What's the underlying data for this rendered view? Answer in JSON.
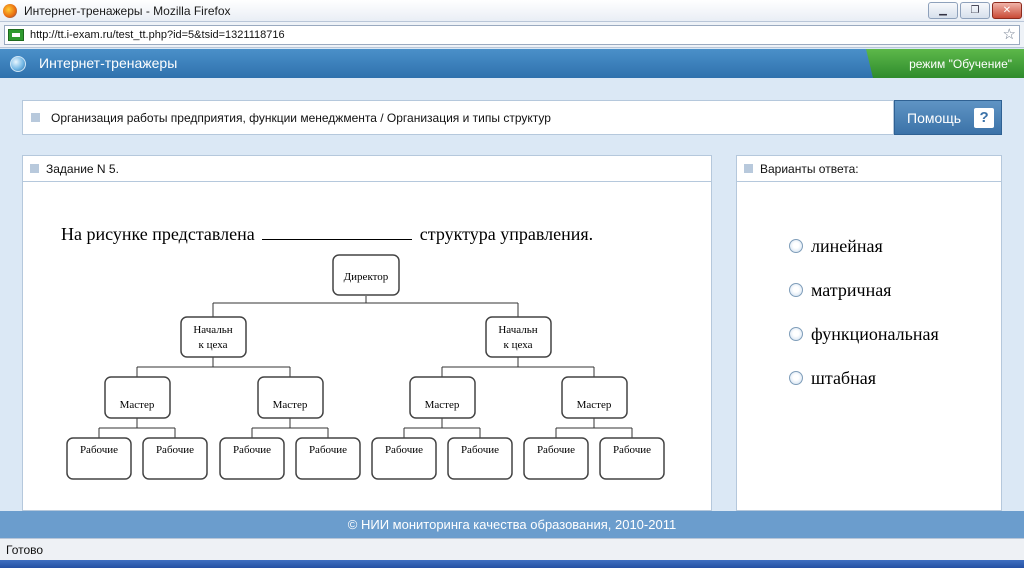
{
  "window": {
    "title": "Интернет-тренажеры - Mozilla Firefox",
    "buttons": {
      "minimize": "▁",
      "maximize": "❐",
      "close": "✕"
    }
  },
  "address_bar": {
    "url": "http://tt.i-exam.ru/test_tt.php?id=5&tsid=1321118716",
    "bookmark_icon": "star-icon"
  },
  "app_header": {
    "title": "Интернет-тренажеры",
    "mode": "режим \"Обучение\""
  },
  "breadcrumb": {
    "text": "Организация работы предприятия, функции менеджмента / Организация и типы структур"
  },
  "help": {
    "label": "Помощь",
    "icon": "?"
  },
  "task": {
    "title": "Задание N 5.",
    "question_before": "На рисунке представлена",
    "question_after": "структура управления.",
    "org_chart": {
      "director": "Директор",
      "heads": [
        "Начальник цеха",
        "Начальник цеха"
      ],
      "head_lines": [
        "Начальн",
        "к цеха"
      ],
      "masters": [
        "Мастер",
        "Мастер",
        "Мастер",
        "Мастер"
      ],
      "workers": [
        "Рабочие",
        "Рабочие",
        "Рабочие",
        "Рабочие",
        "Рабочие",
        "Рабочие",
        "Рабочие",
        "Рабочие"
      ]
    }
  },
  "answers": {
    "title": "Варианты ответа:",
    "options": [
      "линейная",
      "матричная",
      "функциональная",
      "штабная"
    ]
  },
  "footer": {
    "text": "© НИИ мониторинга качества образования, 2010-2011"
  },
  "status": {
    "text": "Готово"
  },
  "colors": {
    "header": "#3a80bd",
    "mode_badge": "#3fa03a",
    "footer": "#6b9dcd",
    "panel_border": "#b5c8dc"
  }
}
